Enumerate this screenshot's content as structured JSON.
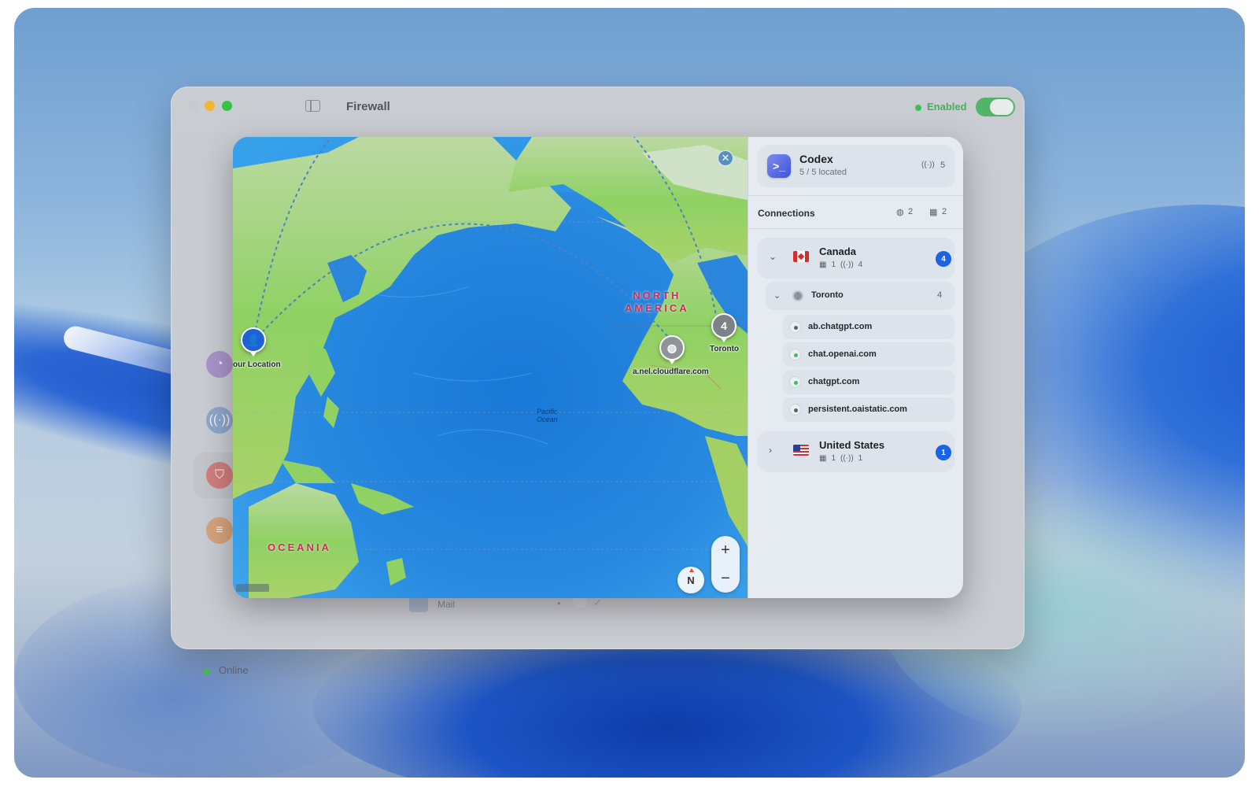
{
  "window": {
    "title": "Firewall",
    "status_label": "Enabled",
    "status_color": "#3bbf57"
  },
  "sidebar": {
    "status_label": "Online",
    "icons": [
      "gauge-icon",
      "antenna-icon",
      "shield-icon",
      "sliders-icon"
    ]
  },
  "background_list": {
    "row_label": "Mail"
  },
  "map": {
    "regions": [
      "NORTH\nAMERICA",
      "OCEANIA"
    ],
    "ocean_label": "Pacific\nOcean",
    "pins": [
      {
        "label": "our Location",
        "icon": "person-icon"
      },
      {
        "label": "a.nel.cloudflare.com",
        "icon": "globe-icon"
      },
      {
        "label": "Toronto",
        "count": "4"
      }
    ],
    "compass_label": "N",
    "zoom_in_label": "+",
    "zoom_out_label": "−"
  },
  "panel": {
    "app": {
      "name": "Codex",
      "subtitle": "5 / 5 located",
      "connection_count": "5"
    },
    "connections": {
      "title": "Connections",
      "globe_count": "2",
      "building_count": "2"
    },
    "countries": [
      {
        "name": "Canada",
        "buildings": "1",
        "connections": "4",
        "badge": "4",
        "cities": [
          {
            "name": "Toronto",
            "count": "4",
            "hosts": [
              {
                "name": "ab.chatgpt.com",
                "status": "gray"
              },
              {
                "name": "chat.openai.com",
                "status": "green"
              },
              {
                "name": "chatgpt.com",
                "status": "green"
              },
              {
                "name": "persistent.oaistatic.com",
                "status": "gray"
              }
            ]
          }
        ]
      },
      {
        "name": "United States",
        "buildings": "1",
        "connections": "1",
        "badge": "1"
      }
    ]
  },
  "colors": {
    "accent": "#1b63e0",
    "region_label": "#d62b58"
  }
}
